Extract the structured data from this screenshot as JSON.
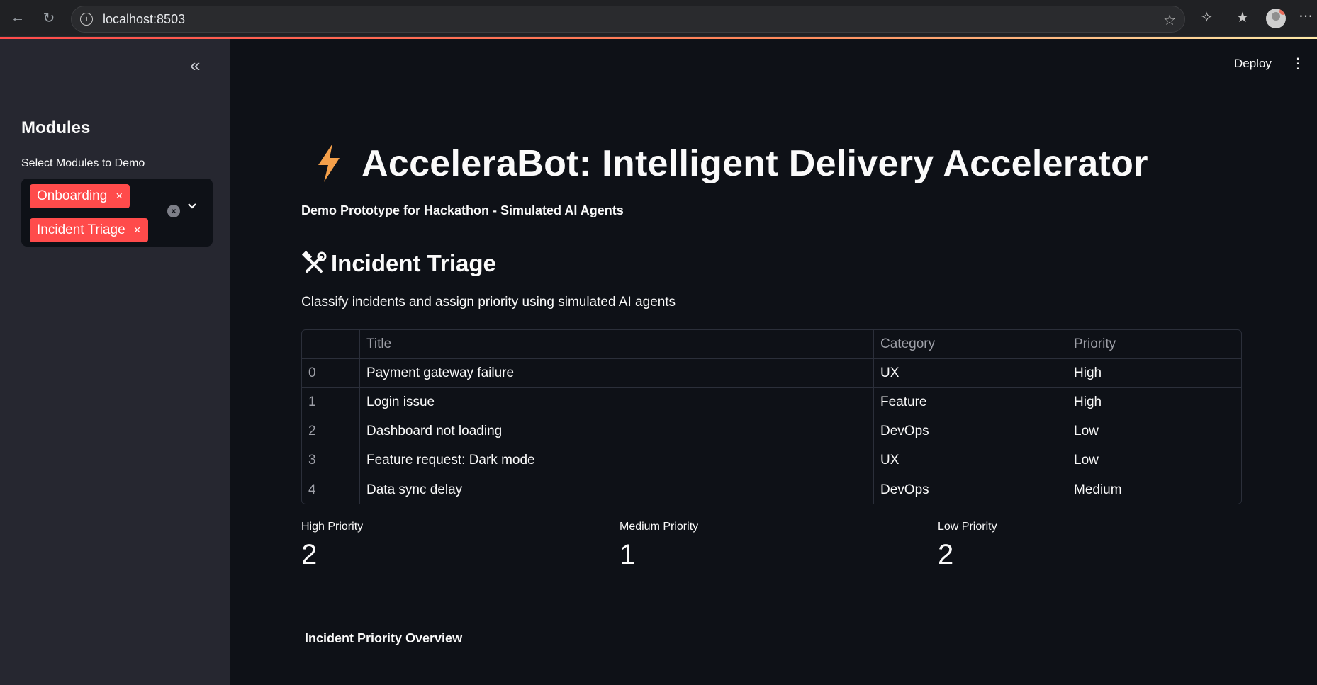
{
  "browser": {
    "url": "localhost:8503",
    "icons": [
      "back-icon",
      "reload-icon",
      "info-icon",
      "star-icon",
      "extensions-icon",
      "favorites-icon",
      "profile-avatar",
      "more-icon"
    ]
  },
  "sidebar": {
    "collapse_icon": "double-chevron-left-icon",
    "title": "Modules",
    "select_label": "Select Modules to Demo",
    "chips": [
      {
        "label": "Onboarding",
        "remove": "×"
      },
      {
        "label": "Incident Triage",
        "remove": "×"
      }
    ]
  },
  "header": {
    "deploy_label": "Deploy",
    "menu_icon": "kebab-menu-icon"
  },
  "main": {
    "title_icon": "lightning-bolt-icon",
    "title": "AcceleraBot: Intelligent Delivery Accelerator",
    "subtitle": "Demo Prototype for Hackathon - Simulated AI Agents",
    "section_icon": "hammer-wrench-icon",
    "section_title": "Incident Triage",
    "section_desc": "Classify incidents and assign priority using simulated AI agents",
    "table": {
      "columns": [
        "",
        "Title",
        "Category",
        "Priority"
      ],
      "rows": [
        [
          "0",
          "Payment gateway failure",
          "UX",
          "High"
        ],
        [
          "1",
          "Login issue",
          "Feature",
          "High"
        ],
        [
          "2",
          "Dashboard not loading",
          "DevOps",
          "Low"
        ],
        [
          "3",
          "Feature request: Dark mode",
          "UX",
          "Low"
        ],
        [
          "4",
          "Data sync delay",
          "DevOps",
          "Medium"
        ]
      ]
    },
    "metrics": [
      {
        "label": "High Priority",
        "value": "2"
      },
      {
        "label": "Medium Priority",
        "value": "1"
      },
      {
        "label": "Low Priority",
        "value": "2"
      }
    ],
    "overview_title": "Incident Priority Overview"
  },
  "colors": {
    "background": "#0e1117",
    "sidebar": "#262730",
    "accent": "#ff4b4b",
    "bolt": "#f5a04a"
  }
}
